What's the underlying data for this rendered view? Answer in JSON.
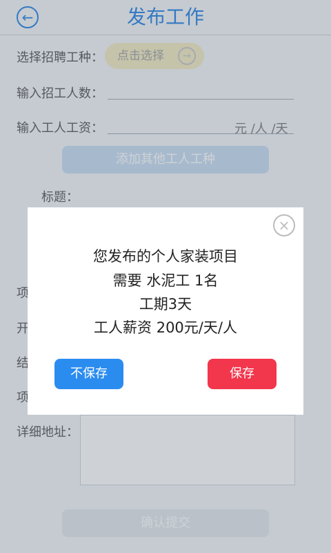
{
  "header": {
    "title": "发布工作",
    "back_icon": "back-circle-arrow-icon"
  },
  "form": {
    "job_type_label": "选择招聘工种：",
    "job_type_button": "点击选择",
    "workers_label": "输入招工人数：",
    "wage_label": "输入工人工资：",
    "wage_unit": "元 /人 /天",
    "add_type_button": "添加其他工人工种",
    "title_label": "标题：",
    "partial_labels": [
      "项",
      "开",
      "结",
      "项"
    ],
    "address_label": "详细地址：",
    "submit_button": "确认提交"
  },
  "dialog": {
    "close_icon": "close-circle-icon",
    "lines": [
      "您发布的个人家装项目",
      "需要 水泥工 1名",
      "工期3天",
      "工人薪资 200元/天/人"
    ],
    "cancel_button": "不保存",
    "save_button": "保存"
  },
  "colors": {
    "accent": "#3a8ee6",
    "save": "#f2364c",
    "no_save": "#2b8cf0"
  }
}
